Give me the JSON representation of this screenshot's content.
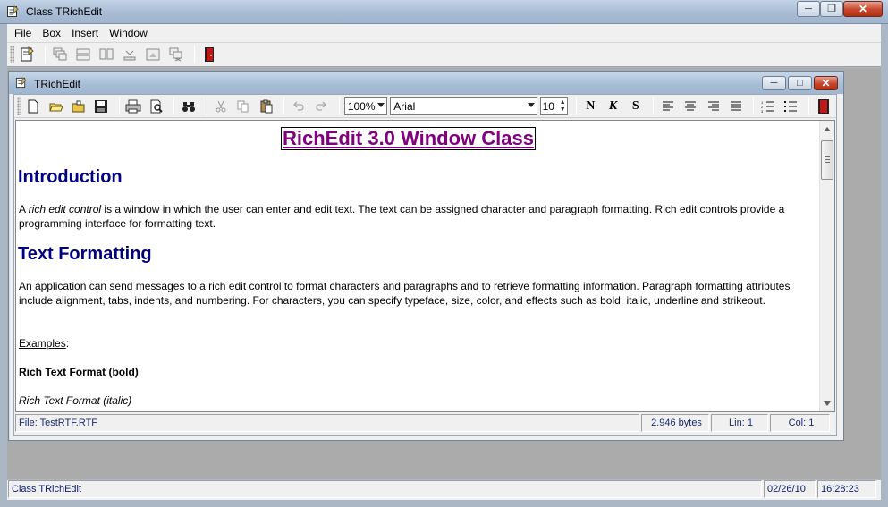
{
  "app": {
    "title": "Class TRichEdit",
    "colors": {
      "titlebar": "#a8bcd4",
      "accent_title": "#800080",
      "heading": "#000080"
    }
  },
  "menu": {
    "items": [
      "File",
      "Box",
      "Insert",
      "Window"
    ]
  },
  "main_toolbar": {
    "icons": [
      "new-document-icon",
      "cascade-icon",
      "tile-horizontal-icon",
      "tile-vertical-icon",
      "minimize-all-icon",
      "arrange-icons-icon",
      "close-all-icon",
      "exit-door-icon"
    ]
  },
  "child": {
    "title": "TRichEdit",
    "toolbar": {
      "zoom": "100%",
      "font": "Arial",
      "size": "10",
      "bold_label": "N",
      "italic_label": "K",
      "strike_label": "S"
    },
    "document": {
      "title": "RichEdit 3.0 Window Class",
      "h_intro": "Introduction",
      "p_intro_a": "A ",
      "p_intro_em": "rich edit control",
      "p_intro_b": " is a window in which the user can enter and edit text. The text can be assigned character and paragraph formatting. Rich edit controls provide a programming interface for formatting text.",
      "h_format": "Text Formatting",
      "p_format": "An application can send messages to a rich edit control to format characters and paragraphs and to retrieve formatting information. Paragraph formatting attributes include alignment, tabs, indents, and numbering. For characters, you can specify typeface, size, color, and effects such as bold, italic, underline and strikeout.",
      "examples_label": "Examples",
      "examples_colon": ":",
      "ex_bold": "Rich Text Format (bold)",
      "ex_italic": "Rich Text Format (italic)"
    },
    "status": {
      "file": "File: TestRTF.RTF",
      "size": "2.946 bytes",
      "line": "Lin: 1",
      "col": "Col: 1"
    }
  },
  "status": {
    "app_name": "Class TRichEdit",
    "date": "02/26/10",
    "time": "16:28:23"
  }
}
